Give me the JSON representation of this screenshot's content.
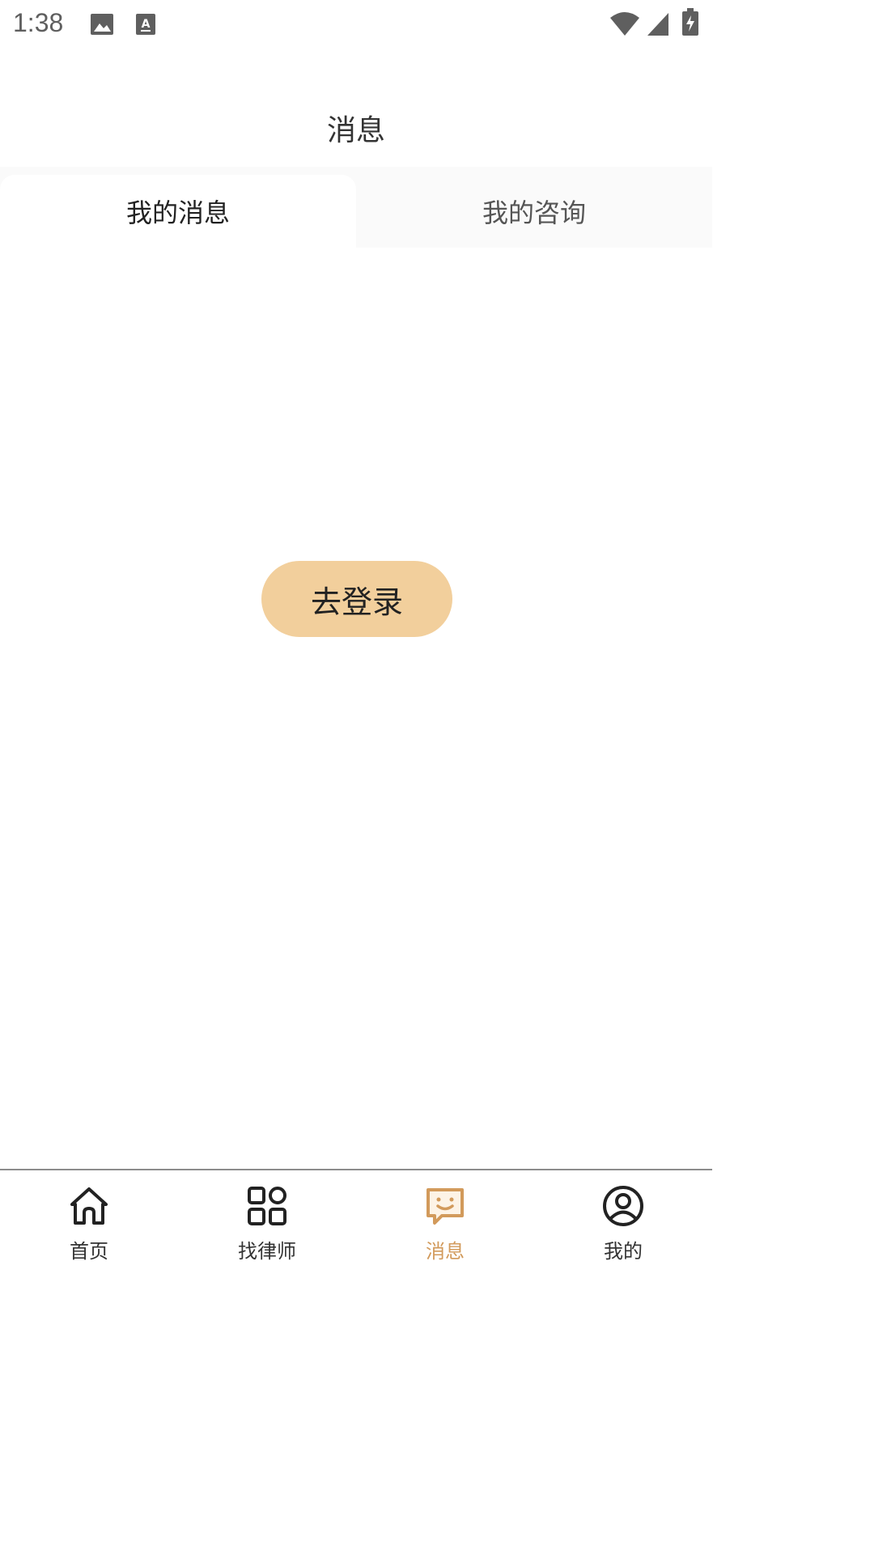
{
  "status_bar": {
    "time": "1:38"
  },
  "header": {
    "title": "消息"
  },
  "tabs": [
    {
      "label": "我的消息",
      "active": true
    },
    {
      "label": "我的咨询",
      "active": false
    }
  ],
  "main": {
    "login_button": "去登录"
  },
  "bottom_nav": {
    "items": [
      {
        "label": "首页",
        "icon": "home-icon"
      },
      {
        "label": "找律师",
        "icon": "grid-icon"
      },
      {
        "label": "消息",
        "icon": "message-icon",
        "active": true
      },
      {
        "label": "我的",
        "icon": "profile-icon"
      }
    ]
  },
  "colors": {
    "accent": "#d29a5b",
    "button_bg": "#f2cf9c"
  }
}
